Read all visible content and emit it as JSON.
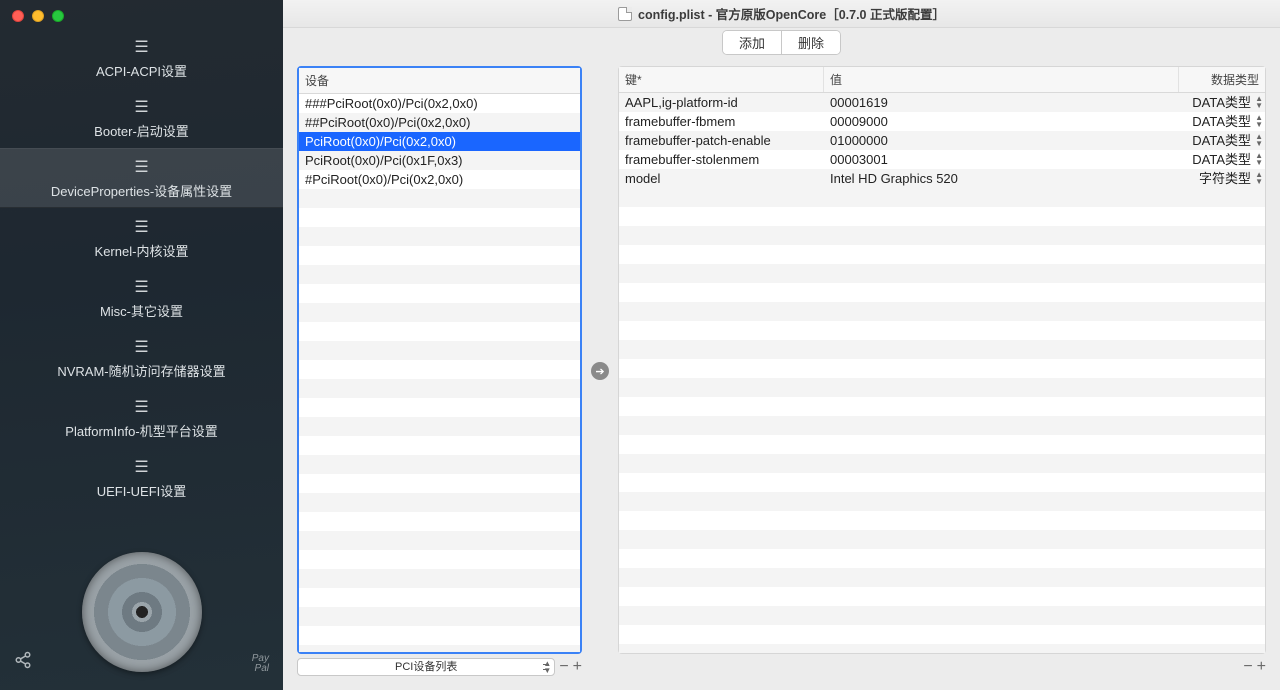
{
  "titlebar": {
    "text": "config.plist - 官方原版OpenCore［0.7.0 正式版配置］"
  },
  "toolbar": {
    "add": "添加",
    "delete": "删除"
  },
  "sidebar": {
    "items": [
      {
        "label": "ACPI-ACPI设置"
      },
      {
        "label": "Booter-启动设置"
      },
      {
        "label": "DeviceProperties-设备属性设置"
      },
      {
        "label": "Kernel-内核设置"
      },
      {
        "label": "Misc-其它设置"
      },
      {
        "label": "NVRAM-随机访问存储器设置"
      },
      {
        "label": "PlatformInfo-机型平台设置"
      },
      {
        "label": "UEFI-UEFI设置"
      }
    ],
    "active_index": 2,
    "paypal": "Pay\nPal"
  },
  "devices": {
    "header": "设备",
    "rows": [
      "###PciRoot(0x0)/Pci(0x2,0x0)",
      "##PciRoot(0x0)/Pci(0x2,0x0)",
      "PciRoot(0x0)/Pci(0x2,0x0)",
      "PciRoot(0x0)/Pci(0x1F,0x3)",
      "#PciRoot(0x0)/Pci(0x2,0x0)"
    ],
    "selected_index": 2,
    "combo": "PCI设备列表"
  },
  "props": {
    "headers": {
      "key": "键*",
      "value": "值",
      "type": "数据类型"
    },
    "rows": [
      {
        "key": "AAPL,ig-platform-id",
        "value": "00001619",
        "type": "DATA类型"
      },
      {
        "key": "framebuffer-fbmem",
        "value": "00009000",
        "type": "DATA类型"
      },
      {
        "key": "framebuffer-patch-enable",
        "value": "01000000",
        "type": "DATA类型"
      },
      {
        "key": "framebuffer-stolenmem",
        "value": "00003001",
        "type": "DATA类型"
      },
      {
        "key": "model",
        "value": "Intel HD Graphics 520",
        "type": "字符类型"
      }
    ]
  }
}
